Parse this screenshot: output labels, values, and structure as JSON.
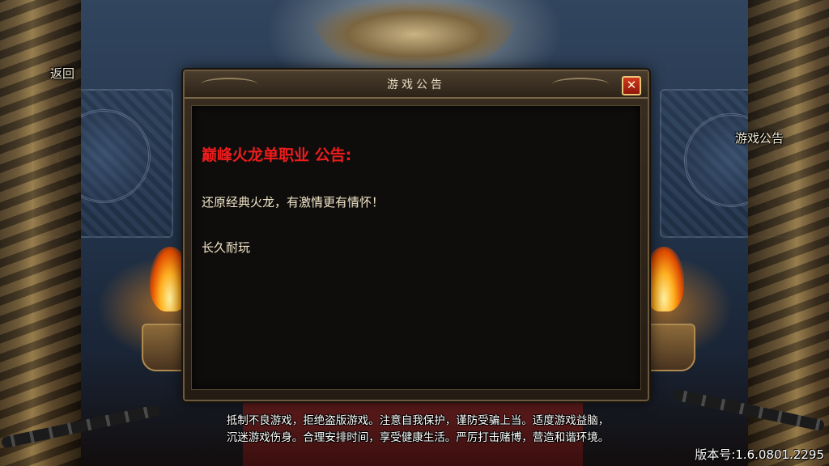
{
  "nav": {
    "back_label": "返回",
    "announcement_label": "游戏公告"
  },
  "dialog": {
    "title": "游戏公告",
    "close_glyph": "✕",
    "heading": "巅峰火龙单职业 公告:",
    "lines": [
      "还原经典火龙，有激情更有情怀！",
      "长久耐玩"
    ]
  },
  "footer": {
    "advisory_line1": "抵制不良游戏，拒绝盗版游戏。注意自我保护，谨防受骗上当。适度游戏益脑，",
    "advisory_line2": "沉迷游戏伤身。合理安排时间，享受健康生活。严厉打击赌博，营造和谐环境。",
    "version": "版本号:1.6.0801.2295"
  },
  "colors": {
    "heading_red": "#ee1c1c",
    "body_text": "#f2e6c8",
    "frame_gold": "#6b5a40"
  }
}
